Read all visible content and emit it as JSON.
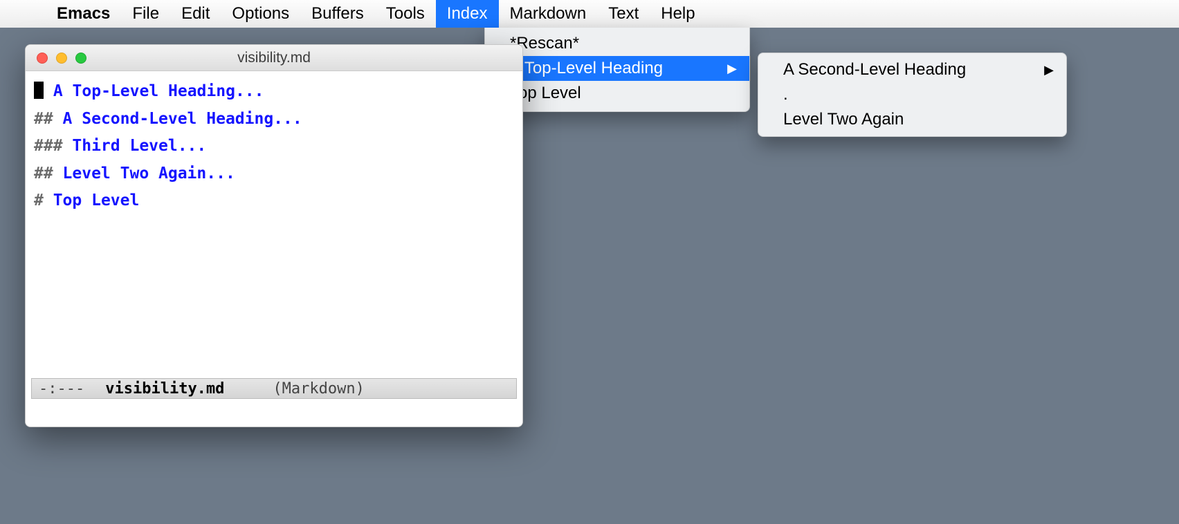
{
  "menubar": {
    "apple": "",
    "items": [
      {
        "label": "Emacs",
        "appname": true
      },
      {
        "label": "File"
      },
      {
        "label": "Edit"
      },
      {
        "label": "Options"
      },
      {
        "label": "Buffers"
      },
      {
        "label": "Tools"
      },
      {
        "label": "Index",
        "active": true
      },
      {
        "label": "Markdown"
      },
      {
        "label": "Text"
      },
      {
        "label": "Help"
      }
    ]
  },
  "dropdown": {
    "items": [
      {
        "label": "*Rescan*",
        "hasSubmenu": false,
        "highlighted": false
      },
      {
        "label": "A Top-Level Heading",
        "hasSubmenu": true,
        "highlighted": true
      },
      {
        "label": "Top Level",
        "hasSubmenu": false,
        "highlighted": false
      }
    ]
  },
  "submenu": {
    "items": [
      {
        "label": "A Second-Level Heading",
        "hasSubmenu": true
      },
      {
        "label": ".",
        "hasSubmenu": false
      },
      {
        "label": "Level Two Again",
        "hasSubmenu": false
      }
    ]
  },
  "window": {
    "title": "visibility.md",
    "buffer": {
      "lines": [
        {
          "prefix": "",
          "cursor": true,
          "hash": "",
          "heading": " A Top-Level Heading..."
        },
        {
          "prefix": "",
          "cursor": false,
          "hash": "## ",
          "heading": "A Second-Level Heading..."
        },
        {
          "prefix": "",
          "cursor": false,
          "hash": "### ",
          "heading": "Third Level..."
        },
        {
          "prefix": "",
          "cursor": false,
          "hash": "## ",
          "heading": "Level Two Again..."
        },
        {
          "prefix": "",
          "cursor": false,
          "hash": "# ",
          "heading": "Top Level"
        }
      ]
    },
    "modeline": {
      "status": "-:---",
      "filename": "visibility.md",
      "mode": "(Markdown)"
    }
  }
}
